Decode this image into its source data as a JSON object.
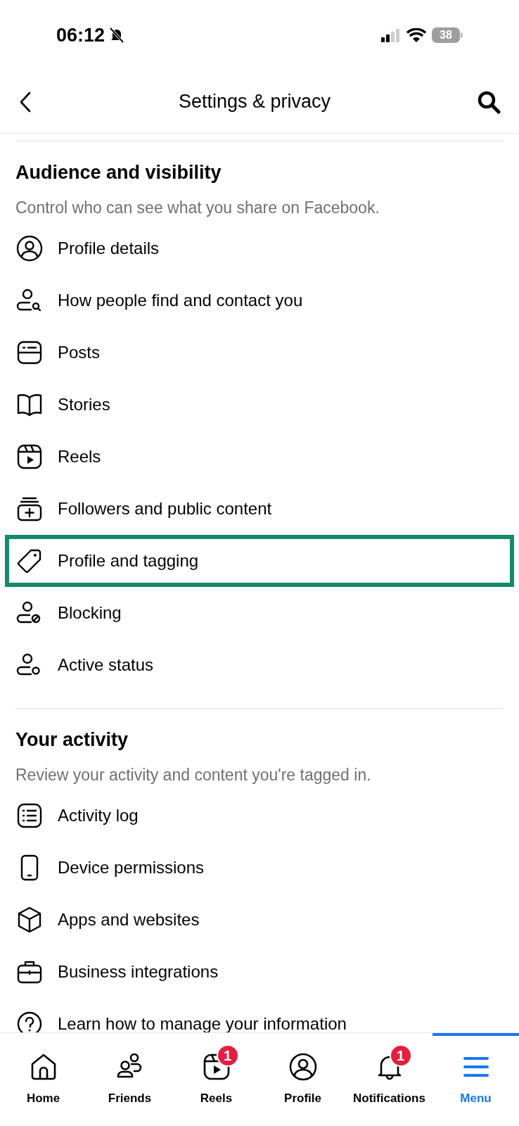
{
  "status_bar": {
    "time": "06:12",
    "battery": "38"
  },
  "header": {
    "title": "Settings & privacy"
  },
  "sections": [
    {
      "title": "Audience and visibility",
      "subtitle": "Control who can see what you share on Facebook.",
      "items": [
        {
          "label": "Profile details",
          "highlighted": false
        },
        {
          "label": "How people find and contact you",
          "highlighted": false
        },
        {
          "label": "Posts",
          "highlighted": false
        },
        {
          "label": "Stories",
          "highlighted": false
        },
        {
          "label": "Reels",
          "highlighted": false
        },
        {
          "label": "Followers and public content",
          "highlighted": false
        },
        {
          "label": "Profile and tagging",
          "highlighted": true
        },
        {
          "label": "Blocking",
          "highlighted": false
        },
        {
          "label": "Active status",
          "highlighted": false
        }
      ]
    },
    {
      "title": "Your activity",
      "subtitle": "Review your activity and content you're tagged in.",
      "items": [
        {
          "label": "Activity log",
          "highlighted": false
        },
        {
          "label": "Device permissions",
          "highlighted": false
        },
        {
          "label": "Apps and websites",
          "highlighted": false
        },
        {
          "label": "Business integrations",
          "highlighted": false
        },
        {
          "label": "Learn how to manage your information",
          "highlighted": false
        }
      ]
    }
  ],
  "tab_bar": [
    {
      "label": "Home",
      "selected": false
    },
    {
      "label": "Friends",
      "selected": false
    },
    {
      "label": "Reels",
      "selected": false,
      "badge": "1"
    },
    {
      "label": "Profile",
      "selected": false
    },
    {
      "label": "Notifications",
      "selected": false,
      "badge": "1"
    },
    {
      "label": "Menu",
      "selected": true
    }
  ]
}
